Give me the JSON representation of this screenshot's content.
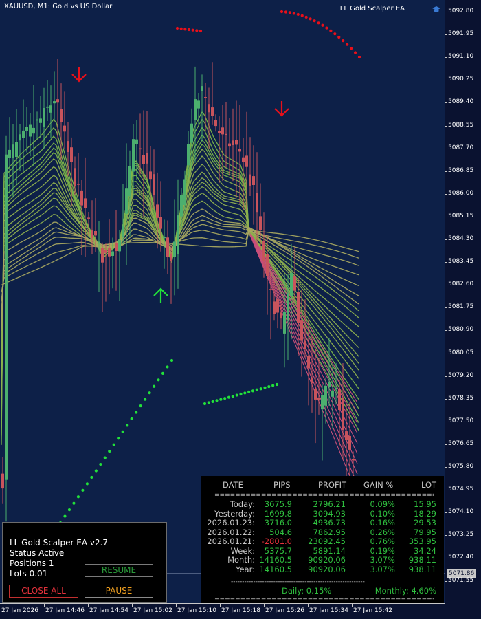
{
  "window": {
    "symbol_title": "XAUUSD, M1:  Gold vs US Dollar",
    "ea_tag": "LL Gold Scalper EA"
  },
  "price_axis": {
    "labels": [
      "5092.80",
      "5091.95",
      "5091.10",
      "5090.25",
      "5089.40",
      "5088.55",
      "5087.70",
      "5086.85",
      "5086.00",
      "5085.15",
      "5084.30",
      "5083.45",
      "5082.60",
      "5081.75",
      "5080.90",
      "5080.05",
      "5079.20",
      "5078.35",
      "5077.50",
      "5076.65",
      "5075.80",
      "5074.95",
      "5074.10",
      "5073.25",
      "5072.40",
      "5071.55"
    ],
    "current_price": "5071.86"
  },
  "time_axis": {
    "labels": [
      "27 Jan 2026",
      "27 Jan 14:46",
      "27 Jan 14:54",
      "27 Jan 15:02",
      "27 Jan 15:10",
      "27 Jan 15:18",
      "27 Jan 15:26",
      "27 Jan 15:34",
      "27 Jan 15:42"
    ]
  },
  "ea_panel": {
    "title": "LL Gold Scalper EA",
    "version": "v2.7",
    "status_label": "Status",
    "status_value": "Active",
    "positions_label": "Positions",
    "positions_value": "1",
    "lots_label": "Lots",
    "lots_value": "0.01",
    "resume_label": "RESUME",
    "close_all_label": "CLOSE ALL",
    "pause_label": "PAUSE"
  },
  "stats_table": {
    "headers": [
      "DATE",
      "PIPS",
      "PROFIT",
      "GAIN %",
      "LOT"
    ],
    "separator": "====================================================",
    "rows": [
      {
        "date": "Today:",
        "pips": "3675.9",
        "profit": "2796.21",
        "gain": "0.09%",
        "lot": "15.95",
        "negative": false
      },
      {
        "date": "Yesterday:",
        "pips": "1699.8",
        "profit": "3094.93",
        "gain": "0.10%",
        "lot": "18.29",
        "negative": false
      },
      {
        "date": "2026.01.23:",
        "pips": "3716.0",
        "profit": "4936.73",
        "gain": "0.16%",
        "lot": "29.53",
        "negative": false
      },
      {
        "date": "2026.01.22:",
        "pips": "504.6",
        "profit": "7862.95",
        "gain": "0.26%",
        "lot": "79.95",
        "negative": false
      },
      {
        "date": "2026.01.21:",
        "pips": "-2801.0",
        "profit": "23092.45",
        "gain": "0.76%",
        "lot": "353.95",
        "negative": true
      },
      {
        "date": "Week:",
        "pips": "5375.7",
        "profit": "5891.14",
        "gain": "0.19%",
        "lot": "34.24",
        "negative": false
      },
      {
        "date": "Month:",
        "pips": "14160.5",
        "profit": "90920.06",
        "gain": "3.07%",
        "lot": "938.11",
        "negative": false
      },
      {
        "date": "Year:",
        "pips": "14160.5",
        "profit": "90920.06",
        "gain": "3.07%",
        "lot": "938.11",
        "negative": false
      }
    ],
    "dash_separator": "------------------------------------------------------------",
    "daily": "Daily: 0.15%",
    "monthly": "Monthly: 4.60%"
  },
  "colors": {
    "background": "#0d2048",
    "bull_candle": "#4caf6e",
    "bear_candle": "#c8545c",
    "ribbon_up": "#7db64a",
    "ribbon_flat": "#a8a860",
    "ribbon_down": "#c94f7a",
    "buy_signal": "#22e03a",
    "sell_signal": "#e8101a"
  }
}
